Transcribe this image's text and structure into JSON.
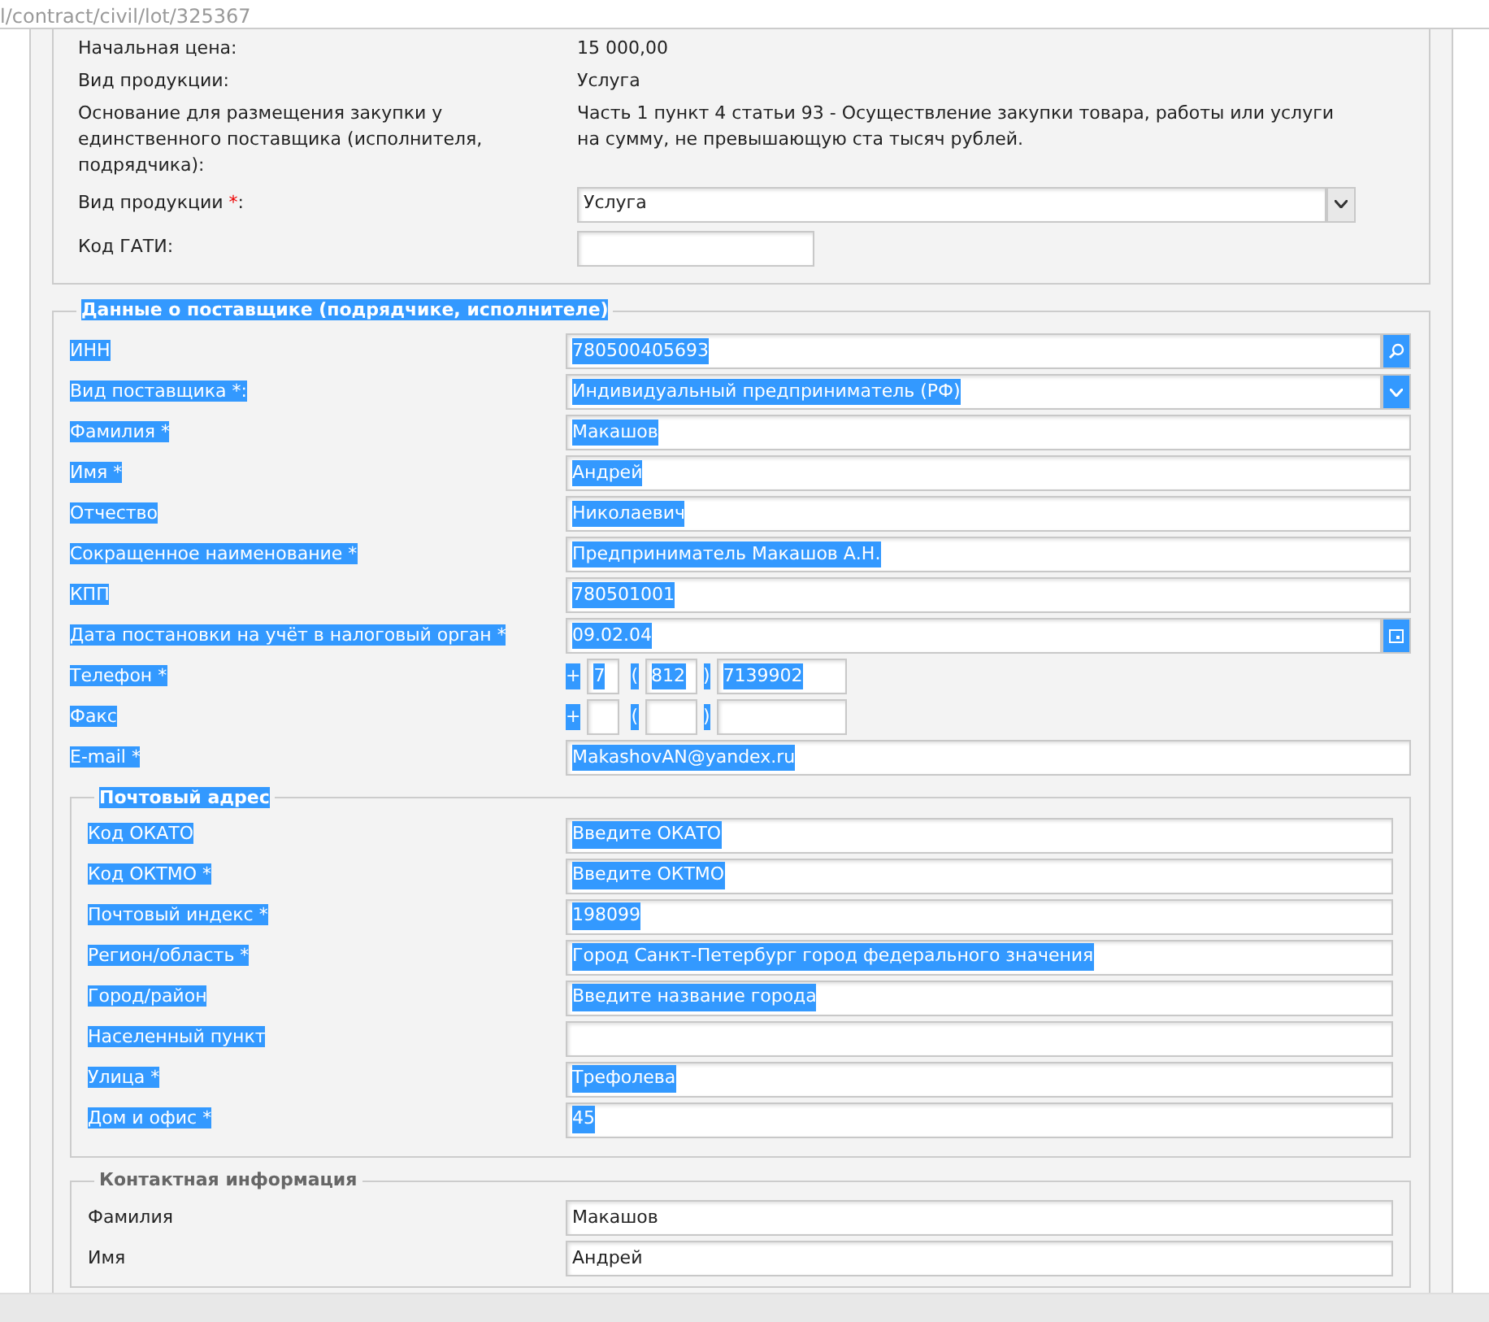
{
  "address_bar": {
    "url": "l/contract/civil/lot/325367"
  },
  "lot_info": {
    "rows": [
      {
        "label": "Начальная цена:",
        "value": "15 000,00"
      },
      {
        "label": "Вид продукции:",
        "value": "Услуга"
      },
      {
        "label": "Основание для размещения закупки у единственного поставщика (исполнителя, подрядчика):",
        "value": "Часть 1 пункт 4 статьи 93 - Осуществление закупки товара, работы или услуги на сумму, не превышающую ста тысяч рублей."
      }
    ],
    "product_type": {
      "label": "Вид продукции",
      "required_mark": "*",
      "label_suffix": ":",
      "value": "Услуга"
    },
    "gati": {
      "label": "Код ГАТИ:"
    }
  },
  "supplier": {
    "legend": "Данные о поставщике (подрядчике, исполнителе)",
    "highlighted": true,
    "fields": [
      {
        "kind": "search",
        "label": "ИНН",
        "value": "780500405693"
      },
      {
        "kind": "select",
        "label": "Вид поставщика *:",
        "value": "Индивидуальный предприниматель (РФ)"
      },
      {
        "kind": "text",
        "label": "Фамилия *",
        "value": "Макашов"
      },
      {
        "kind": "text",
        "label": "Имя *",
        "value": "Андрей"
      },
      {
        "kind": "text",
        "label": "Отчество",
        "value": "Николаевич"
      },
      {
        "kind": "text",
        "label": "Сокращенное наименование *",
        "value": "Предприниматель Макашов А.Н."
      },
      {
        "kind": "text",
        "label": "КПП",
        "value": "780501001"
      },
      {
        "kind": "date",
        "label": "Дата постановки на учёт в налоговый орган *",
        "value": "09.02.04"
      },
      {
        "kind": "phone",
        "label": "Телефон *",
        "plus": "+",
        "country": "7",
        "open": "(",
        "area": "812",
        "close": ")",
        "number": "7139902"
      },
      {
        "kind": "phone",
        "label": "Факс",
        "plus": "+",
        "open": "(",
        "close": ")"
      },
      {
        "kind": "text",
        "label": "E-mail *",
        "value": "MakashovAN@yandex.ru"
      }
    ]
  },
  "postal_address": {
    "legend": "Почтовый адрес",
    "highlighted": true,
    "fields": [
      {
        "label": "Код ОКАТО",
        "placeholder": "Введите ОКАТО"
      },
      {
        "label": "Код ОКТМО *",
        "placeholder": "Введите ОКТМО"
      },
      {
        "label": "Почтовый индекс *",
        "value": "198099"
      },
      {
        "label": "Регион/область *",
        "value": "Город Санкт-Петербург город федерального значения"
      },
      {
        "label": "Город/район",
        "placeholder": "Введите название города"
      },
      {
        "label": "Населенный пункт"
      },
      {
        "label": "Улица *",
        "value": "Трефолева"
      },
      {
        "label": "Дом и офис *",
        "value": "45"
      }
    ]
  },
  "contact_info": {
    "legend": "Контактная информация",
    "highlighted": false,
    "fields": [
      {
        "label": "Фамилия",
        "value": "Макашов"
      },
      {
        "label": "Имя",
        "value": "Андрей"
      }
    ]
  }
}
